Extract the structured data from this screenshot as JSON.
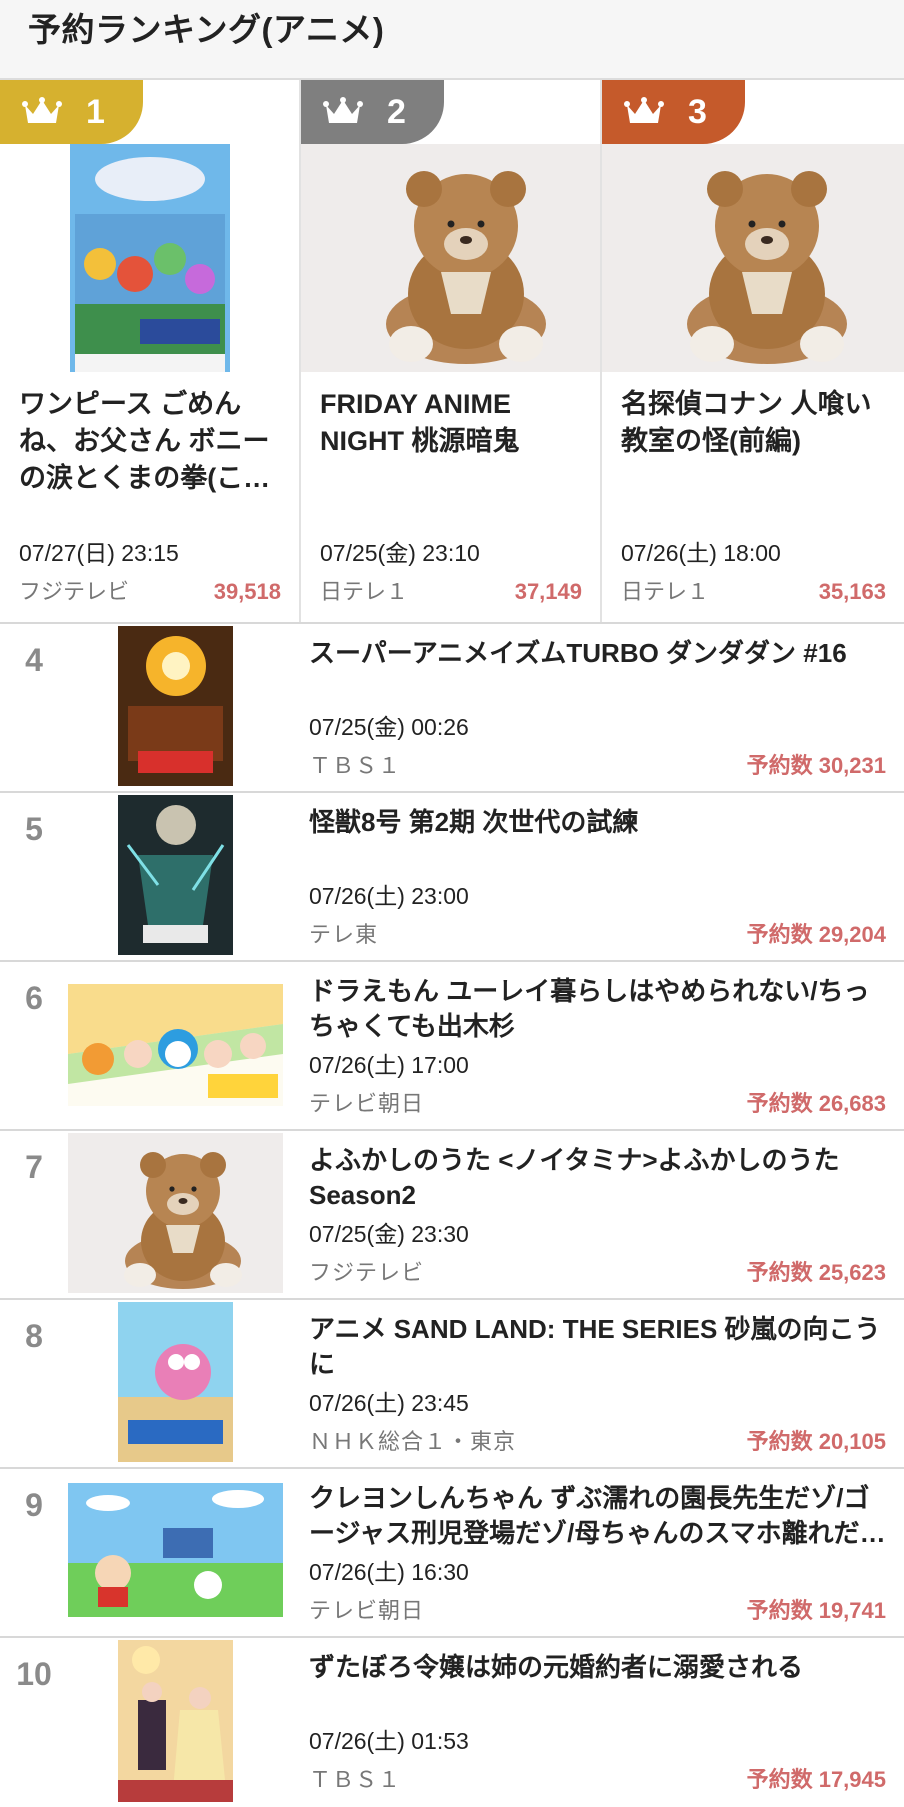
{
  "header": {
    "title": "予約ランキング(アニメ)"
  },
  "colors": {
    "gold": "#D6B12F",
    "silver": "#7F7F7F",
    "bronze": "#C55A2B",
    "count": "#D06A6A"
  },
  "top3": [
    {
      "rank": "1",
      "title": "ワンピース ごめんね、お父さん ボニーの涙とくまの拳(ここから先は画面に表示されていない)",
      "title_visible": "ワンピース ごめんね、お父さん ボニーの涙とくまの拳(こ…",
      "date": "07/27(日) 23:15",
      "channel": "フジテレビ",
      "count": "39,518"
    },
    {
      "rank": "2",
      "title_visible": "FRIDAY ANIME NIGHT 桃源暗鬼",
      "date": "07/25(金) 23:10",
      "channel": "日テレ１",
      "count": "37,149"
    },
    {
      "rank": "3",
      "title_visible": "名探偵コナン 人喰い教室の怪(前編)",
      "date": "07/26(土) 18:00",
      "channel": "日テレ１",
      "count": "35,163"
    }
  ],
  "list": [
    {
      "rank": "4",
      "title": "スーパーアニメイズムTURBO ダンダダン #16",
      "date": "07/25(金) 00:26",
      "channel": "ＴＢＳ１",
      "count": "予約数 30,231"
    },
    {
      "rank": "5",
      "title": "怪獣8号 第2期 次世代の試練",
      "date": "07/26(土) 23:00",
      "channel": "テレ東",
      "count": "予約数 29,204"
    },
    {
      "rank": "6",
      "title": "ドラえもん ユーレイ暮らしはやめられない/ちっちゃくても出木杉",
      "date": "07/26(土) 17:00",
      "channel": "テレビ朝日",
      "count": "予約数 26,683"
    },
    {
      "rank": "7",
      "title": "よふかしのうた <ノイタミナ>よふかしのうた Season2",
      "date": "07/25(金) 23:30",
      "channel": "フジテレビ",
      "count": "予約数 25,623"
    },
    {
      "rank": "8",
      "title": "アニメ SAND LAND: THE SERIES 砂嵐の向こうに",
      "date": "07/26(土) 23:45",
      "channel": "ＮＨＫ総合１・東京",
      "count": "予約数 20,105"
    },
    {
      "rank": "9",
      "title": "クレヨンしんちゃん ずぶ濡れの園長先生だゾ/ゴージャス刑児登場だゾ/母ちゃんのスマホ離れだ…",
      "date": "07/26(土) 16:30",
      "channel": "テレビ朝日",
      "count": "予約数 19,741"
    },
    {
      "rank": "10",
      "title": "ずたぼろ令嬢は姉の元婚約者に溺愛される",
      "date": "07/26(土) 01:53",
      "channel": "ＴＢＳ１",
      "count": "予約数 17,945"
    }
  ]
}
